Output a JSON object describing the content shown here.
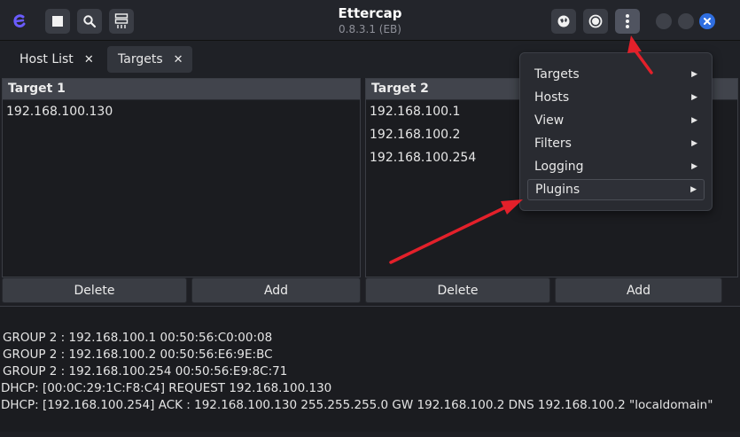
{
  "window": {
    "title": "Ettercap",
    "version": "0.8.3.1 (EB)"
  },
  "icons": {
    "app_logo": "ettercap-logo-icon",
    "stop": "stop-square-icon",
    "search": "search-icon",
    "hosts": "host-list-icon",
    "globe": "globe-icon",
    "record": "record-icon",
    "menu": "vertical-ellipsis-icon"
  },
  "tabs": [
    {
      "label": "Host List",
      "close": "✕"
    },
    {
      "label": "Targets",
      "close": "✕"
    }
  ],
  "target1": {
    "header": "Target 1",
    "rows": [
      "192.168.100.130"
    ],
    "delete_label": "Delete",
    "add_label": "Add"
  },
  "target2": {
    "header": "Target 2",
    "rows": [
      "192.168.100.1",
      "192.168.100.2",
      "192.168.100.254"
    ],
    "delete_label": "Delete",
    "add_label": "Add"
  },
  "menu": {
    "items": [
      {
        "label": "Targets"
      },
      {
        "label": "Hosts"
      },
      {
        "label": "View"
      },
      {
        "label": "Filters"
      },
      {
        "label": "Logging"
      },
      {
        "label": "Plugins",
        "highlighted": true
      }
    ]
  },
  "log": {
    "lines": [
      "GROUP 2 : 192.168.100.1 00:50:56:C0:00:08",
      " GROUP 2 : 192.168.100.2 00:50:56:E6:9E:BC",
      " GROUP 2 : 192.168.100.254 00:50:56:E9:8C:71",
      "DHCP: [00:0C:29:1C:F8:C4] REQUEST 192.168.100.130",
      "DHCP: [192.168.100.254] ACK : 192.168.100.130 255.255.255.0 GW 192.168.100.2 DNS 192.168.100.2 \"localdomain\""
    ]
  },
  "colors": {
    "accent": "#2f6ee0",
    "annotation_arrow": "#e3202a"
  }
}
